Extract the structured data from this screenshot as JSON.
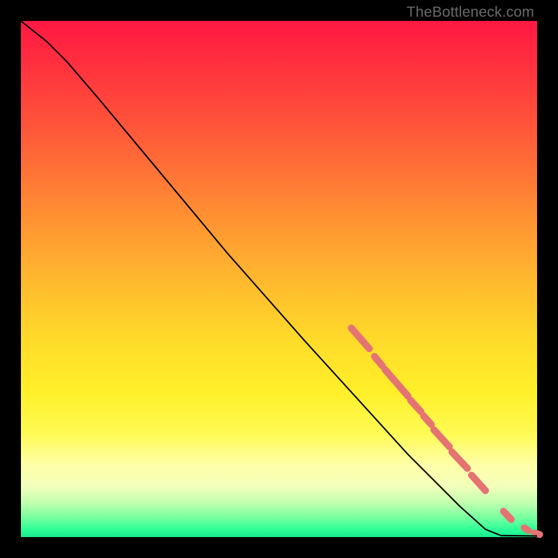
{
  "watermark": "TheBottleneck.com",
  "chart_data": {
    "type": "line",
    "title": "",
    "xlabel": "",
    "ylabel": "",
    "xlim": [
      0,
      100
    ],
    "ylim": [
      0,
      100
    ],
    "grid": false,
    "legend": false,
    "series": [
      {
        "name": "curve",
        "color": "#000000",
        "stroke_width": 2,
        "points": [
          {
            "x": 0,
            "y": 100
          },
          {
            "x": 5,
            "y": 96
          },
          {
            "x": 9,
            "y": 92
          },
          {
            "x": 15,
            "y": 85
          },
          {
            "x": 25,
            "y": 73
          },
          {
            "x": 40,
            "y": 55
          },
          {
            "x": 55,
            "y": 38
          },
          {
            "x": 65,
            "y": 27
          },
          {
            "x": 75,
            "y": 16
          },
          {
            "x": 85,
            "y": 6
          },
          {
            "x": 90,
            "y": 1.5
          },
          {
            "x": 93,
            "y": 0.3
          },
          {
            "x": 100,
            "y": 0.2
          }
        ]
      }
    ],
    "highlight_segments": {
      "color": "#e57373",
      "stroke_width": 10,
      "segments": [
        {
          "x1": 64,
          "y1": 40.5,
          "x2": 67.5,
          "y2": 36.5
        },
        {
          "x1": 68.5,
          "y1": 35.0,
          "x2": 70.0,
          "y2": 33.2
        },
        {
          "x1": 70.5,
          "y1": 32.5,
          "x2": 75.0,
          "y2": 27.3
        },
        {
          "x1": 75.5,
          "y1": 26.5,
          "x2": 77.5,
          "y2": 24.3
        },
        {
          "x1": 78.0,
          "y1": 23.5,
          "x2": 79.5,
          "y2": 21.8
        },
        {
          "x1": 80.0,
          "y1": 20.8,
          "x2": 83.0,
          "y2": 17.5
        },
        {
          "x1": 83.5,
          "y1": 16.5,
          "x2": 86.5,
          "y2": 13.3
        },
        {
          "x1": 87.3,
          "y1": 12.0,
          "x2": 90.0,
          "y2": 9.0
        },
        {
          "x1": 93.5,
          "y1": 5.0,
          "x2": 95.0,
          "y2": 3.4
        },
        {
          "x1": 97.5,
          "y1": 1.8,
          "x2": 98.3,
          "y2": 1.3
        },
        {
          "x1": 99.5,
          "y1": 0.8,
          "x2": 100.5,
          "y2": 0.5
        }
      ]
    }
  }
}
